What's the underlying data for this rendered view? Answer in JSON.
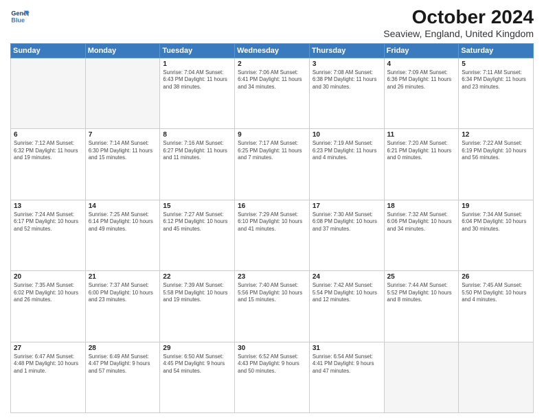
{
  "logo": {
    "line1": "General",
    "line2": "Blue"
  },
  "title": "October 2024",
  "subtitle": "Seaview, England, United Kingdom",
  "weekdays": [
    "Sunday",
    "Monday",
    "Tuesday",
    "Wednesday",
    "Thursday",
    "Friday",
    "Saturday"
  ],
  "weeks": [
    [
      {
        "day": "",
        "info": ""
      },
      {
        "day": "",
        "info": ""
      },
      {
        "day": "1",
        "info": "Sunrise: 7:04 AM\nSunset: 6:43 PM\nDaylight: 11 hours\nand 38 minutes."
      },
      {
        "day": "2",
        "info": "Sunrise: 7:06 AM\nSunset: 6:41 PM\nDaylight: 11 hours\nand 34 minutes."
      },
      {
        "day": "3",
        "info": "Sunrise: 7:08 AM\nSunset: 6:38 PM\nDaylight: 11 hours\nand 30 minutes."
      },
      {
        "day": "4",
        "info": "Sunrise: 7:09 AM\nSunset: 6:36 PM\nDaylight: 11 hours\nand 26 minutes."
      },
      {
        "day": "5",
        "info": "Sunrise: 7:11 AM\nSunset: 6:34 PM\nDaylight: 11 hours\nand 23 minutes."
      }
    ],
    [
      {
        "day": "6",
        "info": "Sunrise: 7:12 AM\nSunset: 6:32 PM\nDaylight: 11 hours\nand 19 minutes."
      },
      {
        "day": "7",
        "info": "Sunrise: 7:14 AM\nSunset: 6:30 PM\nDaylight: 11 hours\nand 15 minutes."
      },
      {
        "day": "8",
        "info": "Sunrise: 7:16 AM\nSunset: 6:27 PM\nDaylight: 11 hours\nand 11 minutes."
      },
      {
        "day": "9",
        "info": "Sunrise: 7:17 AM\nSunset: 6:25 PM\nDaylight: 11 hours\nand 7 minutes."
      },
      {
        "day": "10",
        "info": "Sunrise: 7:19 AM\nSunset: 6:23 PM\nDaylight: 11 hours\nand 4 minutes."
      },
      {
        "day": "11",
        "info": "Sunrise: 7:20 AM\nSunset: 6:21 PM\nDaylight: 11 hours\nand 0 minutes."
      },
      {
        "day": "12",
        "info": "Sunrise: 7:22 AM\nSunset: 6:19 PM\nDaylight: 10 hours\nand 56 minutes."
      }
    ],
    [
      {
        "day": "13",
        "info": "Sunrise: 7:24 AM\nSunset: 6:17 PM\nDaylight: 10 hours\nand 52 minutes."
      },
      {
        "day": "14",
        "info": "Sunrise: 7:25 AM\nSunset: 6:14 PM\nDaylight: 10 hours\nand 49 minutes."
      },
      {
        "day": "15",
        "info": "Sunrise: 7:27 AM\nSunset: 6:12 PM\nDaylight: 10 hours\nand 45 minutes."
      },
      {
        "day": "16",
        "info": "Sunrise: 7:29 AM\nSunset: 6:10 PM\nDaylight: 10 hours\nand 41 minutes."
      },
      {
        "day": "17",
        "info": "Sunrise: 7:30 AM\nSunset: 6:08 PM\nDaylight: 10 hours\nand 37 minutes."
      },
      {
        "day": "18",
        "info": "Sunrise: 7:32 AM\nSunset: 6:06 PM\nDaylight: 10 hours\nand 34 minutes."
      },
      {
        "day": "19",
        "info": "Sunrise: 7:34 AM\nSunset: 6:04 PM\nDaylight: 10 hours\nand 30 minutes."
      }
    ],
    [
      {
        "day": "20",
        "info": "Sunrise: 7:35 AM\nSunset: 6:02 PM\nDaylight: 10 hours\nand 26 minutes."
      },
      {
        "day": "21",
        "info": "Sunrise: 7:37 AM\nSunset: 6:00 PM\nDaylight: 10 hours\nand 23 minutes."
      },
      {
        "day": "22",
        "info": "Sunrise: 7:39 AM\nSunset: 5:58 PM\nDaylight: 10 hours\nand 19 minutes."
      },
      {
        "day": "23",
        "info": "Sunrise: 7:40 AM\nSunset: 5:56 PM\nDaylight: 10 hours\nand 15 minutes."
      },
      {
        "day": "24",
        "info": "Sunrise: 7:42 AM\nSunset: 5:54 PM\nDaylight: 10 hours\nand 12 minutes."
      },
      {
        "day": "25",
        "info": "Sunrise: 7:44 AM\nSunset: 5:52 PM\nDaylight: 10 hours\nand 8 minutes."
      },
      {
        "day": "26",
        "info": "Sunrise: 7:45 AM\nSunset: 5:50 PM\nDaylight: 10 hours\nand 4 minutes."
      }
    ],
    [
      {
        "day": "27",
        "info": "Sunrise: 6:47 AM\nSunset: 4:48 PM\nDaylight: 10 hours\nand 1 minute."
      },
      {
        "day": "28",
        "info": "Sunrise: 6:49 AM\nSunset: 4:47 PM\nDaylight: 9 hours\nand 57 minutes."
      },
      {
        "day": "29",
        "info": "Sunrise: 6:50 AM\nSunset: 4:45 PM\nDaylight: 9 hours\nand 54 minutes."
      },
      {
        "day": "30",
        "info": "Sunrise: 6:52 AM\nSunset: 4:43 PM\nDaylight: 9 hours\nand 50 minutes."
      },
      {
        "day": "31",
        "info": "Sunrise: 6:54 AM\nSunset: 4:41 PM\nDaylight: 9 hours\nand 47 minutes."
      },
      {
        "day": "",
        "info": ""
      },
      {
        "day": "",
        "info": ""
      }
    ]
  ]
}
